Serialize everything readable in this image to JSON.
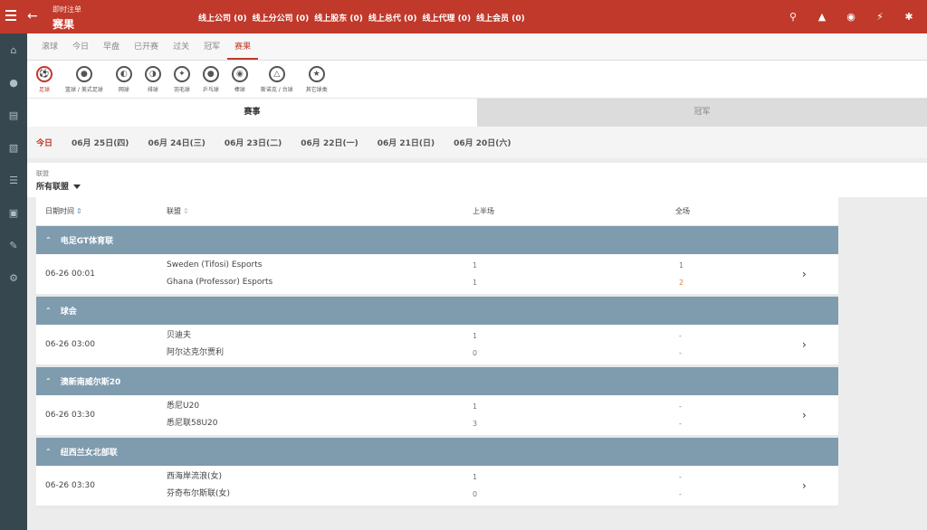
{
  "header": {
    "subtitle": "即时注单",
    "title": "赛果",
    "stats": [
      "线上公司 (0)",
      "线上分公司 (0)",
      "线上股东 (0)",
      "线上总代 (0)",
      "线上代理 (0)",
      "线上会员 (0)"
    ],
    "icons": [
      "search-icon",
      "bell-icon",
      "chat-icon",
      "flash-icon",
      "settings-icon"
    ]
  },
  "rail": [
    "home-icon",
    "users-icon",
    "report-icon",
    "chart-icon",
    "list-icon",
    "clipboard-icon",
    "note-icon",
    "gear-icon"
  ],
  "tabs": [
    "滚球",
    "今日",
    "早盘",
    "已开赛",
    "过关",
    "冠军",
    "赛果"
  ],
  "sports": [
    "足球",
    "篮球 / 美式足球",
    "网球",
    "排球",
    "羽毛球",
    "乒乓球",
    "棒球",
    "斯诺克 / 台球",
    "其它球类"
  ],
  "segments": [
    "赛事",
    "冠军"
  ],
  "dates": [
    "今日",
    "06月 25日(四)",
    "06月 24日(三)",
    "06月 23日(二)",
    "06月 22日(一)",
    "06月 21日(日)",
    "06月 20日(六)"
  ],
  "filter": {
    "label": "联盟",
    "value": "所有联盟"
  },
  "table": {
    "headers": [
      "日期时间",
      "联盟",
      "上半场",
      "全场"
    ],
    "groups": [
      {
        "name": "电足GT体育联",
        "time": "06-26 00:01",
        "home": "Sweden (Tifosi) Esports",
        "away": "Ghana (Professor) Esports",
        "ht": [
          "1",
          "1"
        ],
        "ft": [
          "1",
          "2"
        ]
      },
      {
        "name": "球会",
        "time": "06-26 03:00",
        "home": "贝迪夫",
        "away": "阿尔达克尔贾利",
        "ht": [
          "1",
          "0"
        ],
        "ft": [
          "-",
          "-"
        ]
      },
      {
        "name": "澳新南威尔斯20",
        "time": "06-26 03:30",
        "home": "悉尼U20",
        "away": "悉尼联58U20",
        "ht": [
          "1",
          "3"
        ],
        "ft": [
          "-",
          "-"
        ]
      },
      {
        "name": "纽西兰女北部联",
        "time": "06-26 03:30",
        "home": "西海岸流浪(女)",
        "away": "芬奇布尔斯联(女)",
        "ht": [
          "1",
          "0"
        ],
        "ft": [
          "-",
          "-"
        ]
      }
    ]
  },
  "colors": {
    "brand": "#c0392b",
    "group_header": "#7f9bae",
    "score_highlight": "#e67e22"
  }
}
